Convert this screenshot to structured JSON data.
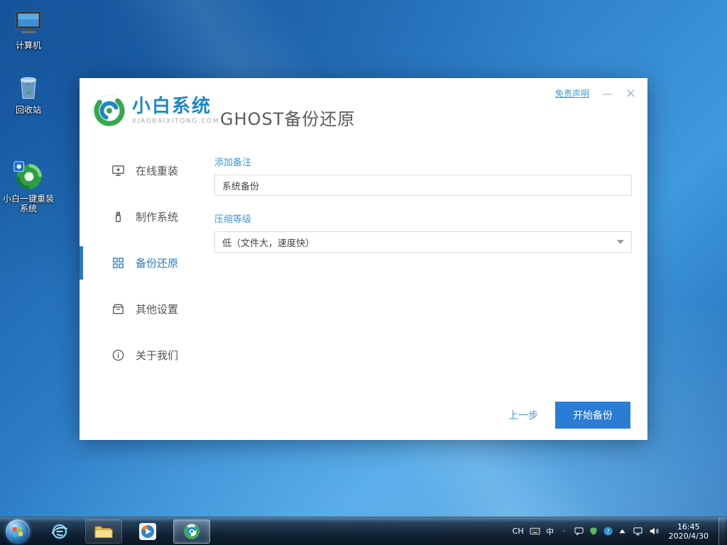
{
  "desktop": {
    "icons": [
      {
        "label": "计算机"
      },
      {
        "label": "回收站"
      },
      {
        "label": "小白一键重装系统"
      }
    ]
  },
  "window": {
    "brand": {
      "name": "小白系统",
      "domain": "XIAOBAIXITONG.COM"
    },
    "page_title": "GHOST备份还原",
    "titlebar": {
      "disclaimer": "免责声明",
      "minimize": "—",
      "close": "×"
    },
    "sidebar": {
      "items": [
        {
          "label": "在线重装"
        },
        {
          "label": "制作系统"
        },
        {
          "label": "备份还原"
        },
        {
          "label": "其他设置"
        },
        {
          "label": "关于我们"
        }
      ]
    },
    "form": {
      "note_label": "添加备注",
      "note_value": "系统备份",
      "compress_label": "压缩等级",
      "compress_value": "低（文件大，速度快）"
    },
    "footer": {
      "back_label": "上一步",
      "start_label": "开始备份"
    }
  },
  "taskbar": {
    "tray": {
      "lang": "CH",
      "ime": "中",
      "punct": "·",
      "time": "16:45",
      "date": "2020/4/30"
    }
  },
  "colors": {
    "accent": "#2a7cd4",
    "link": "#3a9ad9",
    "sidebar_active": "#2a7ac0"
  }
}
